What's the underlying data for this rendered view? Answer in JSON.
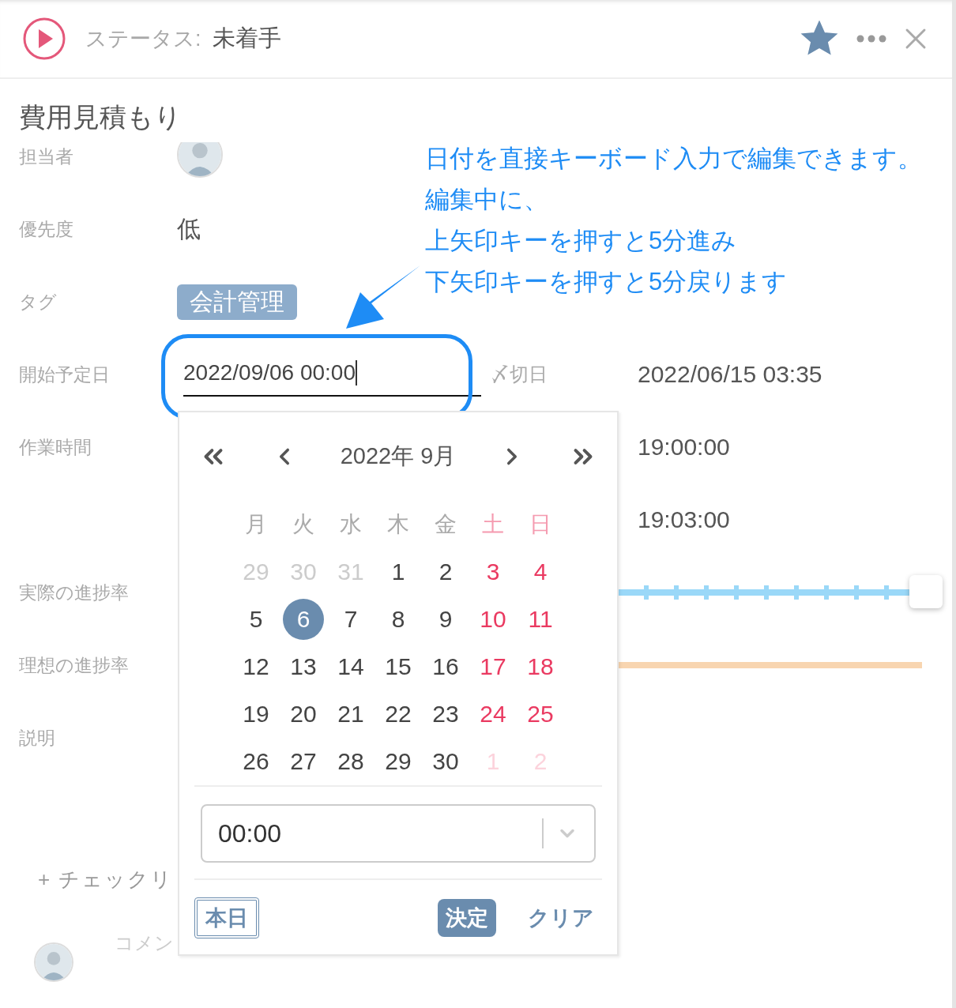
{
  "header": {
    "status_label": "ステータス:",
    "status_value": "未着手",
    "favorite": true
  },
  "title": "費用見積もり",
  "fields": [
    {
      "kind": "assignee",
      "label": "担当者"
    },
    {
      "kind": "text",
      "label": "優先度",
      "value": "低"
    },
    {
      "kind": "tag",
      "label": "タグ",
      "value": "会計管理"
    },
    {
      "kind": "dates",
      "label": "開始予定日",
      "value": "2022/09/06 00:00",
      "due_label": "〆切日",
      "due_value": "2022/06/15 03:35"
    },
    {
      "kind": "time",
      "label": "作業時間",
      "value": "19:00:00"
    },
    {
      "kind": "time_only",
      "value": "19:03:00"
    },
    {
      "kind": "slider",
      "label": "実際の進捗率",
      "level": 1
    },
    {
      "kind": "bar",
      "label": "理想の進捗率",
      "level": 1
    },
    {
      "kind": "heading",
      "label": "説明"
    }
  ],
  "checklist_link": "+ チェックリ",
  "comment": {
    "placeholder": "コメン"
  },
  "calendar": {
    "month_title": "2022年 9月",
    "weekdays": [
      "月",
      "火",
      "水",
      "木",
      "金",
      "土",
      "日"
    ],
    "weeks": [
      [
        {
          "day": "29",
          "muted": true,
          "selected": false
        },
        {
          "day": "30",
          "muted": true,
          "selected": false
        },
        {
          "day": "31",
          "muted": true,
          "selected": false
        },
        {
          "day": "1",
          "muted": false,
          "selected": false
        },
        {
          "day": "2",
          "muted": false,
          "selected": false
        },
        {
          "day": "3",
          "muted": false,
          "selected": false
        },
        {
          "day": "4",
          "muted": false,
          "selected": false
        }
      ],
      [
        {
          "day": "5",
          "muted": false,
          "selected": false
        },
        {
          "day": "6",
          "muted": false,
          "selected": true
        },
        {
          "day": "7",
          "muted": false,
          "selected": false
        },
        {
          "day": "8",
          "muted": false,
          "selected": false
        },
        {
          "day": "9",
          "muted": false,
          "selected": false
        },
        {
          "day": "10",
          "muted": false,
          "selected": false
        },
        {
          "day": "11",
          "muted": false,
          "selected": false
        }
      ],
      [
        {
          "day": "12",
          "muted": false,
          "selected": false
        },
        {
          "day": "13",
          "muted": false,
          "selected": false
        },
        {
          "day": "14",
          "muted": false,
          "selected": false
        },
        {
          "day": "15",
          "muted": false,
          "selected": false
        },
        {
          "day": "16",
          "muted": false,
          "selected": false
        },
        {
          "day": "17",
          "muted": false,
          "selected": false
        },
        {
          "day": "18",
          "muted": false,
          "selected": false
        }
      ],
      [
        {
          "day": "19",
          "muted": false,
          "selected": false
        },
        {
          "day": "20",
          "muted": false,
          "selected": false
        },
        {
          "day": "21",
          "muted": false,
          "selected": false
        },
        {
          "day": "22",
          "muted": false,
          "selected": false
        },
        {
          "day": "23",
          "muted": false,
          "selected": false
        },
        {
          "day": "24",
          "muted": false,
          "selected": false
        },
        {
          "day": "25",
          "muted": false,
          "selected": false
        }
      ],
      [
        {
          "day": "26",
          "muted": false,
          "selected": false
        },
        {
          "day": "27",
          "muted": false,
          "selected": false
        },
        {
          "day": "28",
          "muted": false,
          "selected": false
        },
        {
          "day": "29",
          "muted": false,
          "selected": false
        },
        {
          "day": "30",
          "muted": false,
          "selected": false
        },
        {
          "day": "1",
          "muted": true,
          "selected": false
        },
        {
          "day": "2",
          "muted": true,
          "selected": false
        }
      ]
    ],
    "time_value": "00:00",
    "today_button": "本日",
    "confirm_button": "決定",
    "clear_button": "クリア"
  },
  "annotation": {
    "lines": [
      "日付を直接キーボード入力で編集できます。",
      "編集中に、",
      "上矢印キーを押すと5分進み",
      "下矢印キーを押すと5分戻ります"
    ]
  }
}
